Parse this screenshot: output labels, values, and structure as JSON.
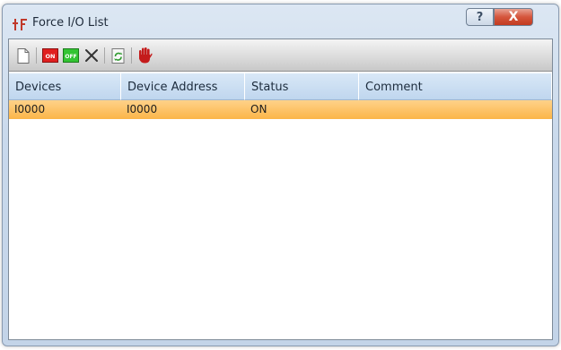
{
  "window": {
    "title": "Force I/O List",
    "help_label": "?",
    "close_label": "X"
  },
  "toolbar": {
    "tools": [
      {
        "name": "new-document-icon"
      },
      {
        "name": "force-on-icon",
        "label": "ON"
      },
      {
        "name": "force-off-icon",
        "label": "OFF"
      },
      {
        "name": "delete-icon"
      },
      {
        "name": "refresh-icon"
      },
      {
        "name": "stop-hand-icon"
      }
    ]
  },
  "table": {
    "columns": [
      "Devices",
      "Device Address",
      "Status",
      "Comment"
    ],
    "rows": [
      {
        "device": "I0000",
        "address": "I0000",
        "status": "ON",
        "comment": ""
      }
    ]
  },
  "colors": {
    "selected_row": "#fbb548",
    "header_bg": "#cfe1f3",
    "on_badge": "#e02020",
    "off_badge": "#33c433",
    "stop_hand": "#c41b1b"
  }
}
